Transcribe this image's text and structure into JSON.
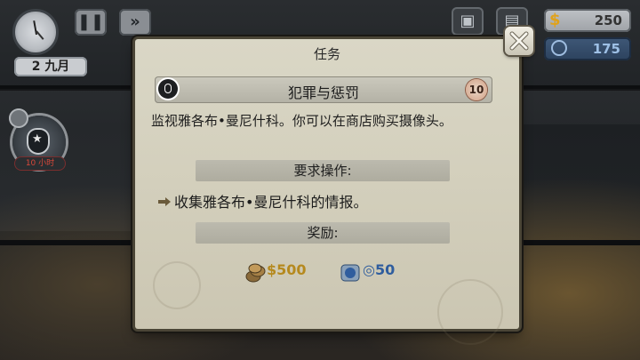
{
  "hud": {
    "date_day": "2",
    "date_month": "九月",
    "money": "250",
    "reputation": "175",
    "task_hours": "10 小时"
  },
  "modal": {
    "title": "任务",
    "mission": {
      "name": "犯罪与惩罚",
      "level": "10",
      "description": "监视雅各布•曼尼什科。你可以在商店购买摄像头。"
    },
    "requirements_label": "要求操作:",
    "requirements": [
      "收集雅各布•曼尼什科的情报。"
    ],
    "rewards_label": "奖励:",
    "rewards": {
      "money": "500",
      "reputation": "50"
    }
  },
  "colors": {
    "money": "#b5891e",
    "reputation": "#2f5d9e",
    "panel": "#d3cfbc"
  }
}
